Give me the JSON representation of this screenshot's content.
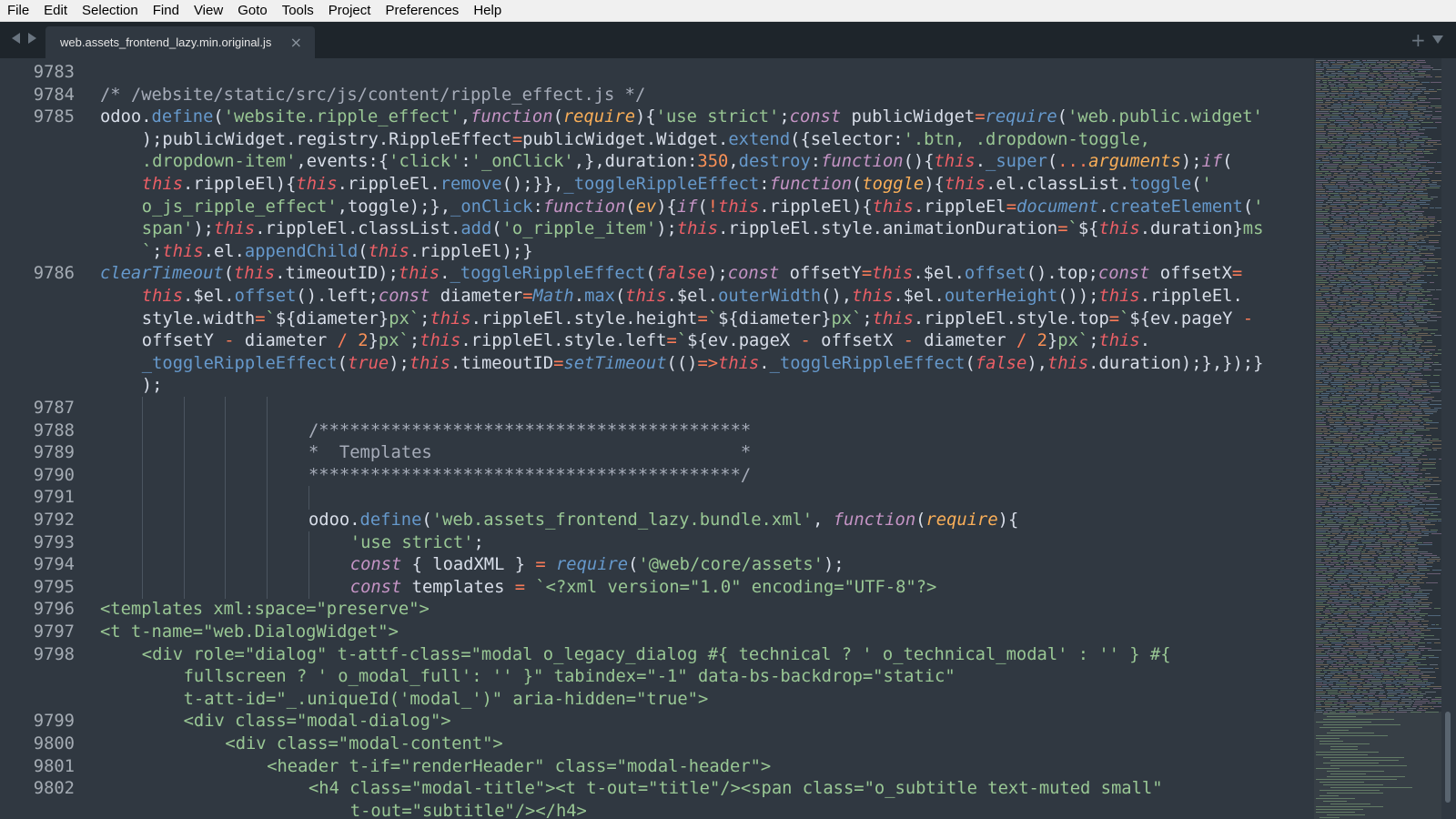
{
  "menu": [
    "File",
    "Edit",
    "Selection",
    "Find",
    "View",
    "Goto",
    "Tools",
    "Project",
    "Preferences",
    "Help"
  ],
  "tab": {
    "title": "web.assets_frontend_lazy.min.original.js",
    "close": "×"
  },
  "tabbar": {
    "new_tab": "+"
  },
  "editor": {
    "lines": [
      {
        "n": "9783",
        "indent": 0,
        "segs": []
      },
      {
        "n": "9784",
        "indent": 0,
        "segs": [
          [
            "c",
            "/* /website/static/src/js/content/ripple_effect.js */"
          ]
        ]
      },
      {
        "n": "9785",
        "indent": 0,
        "segs": [
          [
            "",
            "odoo."
          ],
          [
            "f",
            "define"
          ],
          [
            "",
            "("
          ],
          [
            "s",
            "'website.ripple_effect'"
          ],
          [
            "",
            ","
          ],
          [
            "k",
            "function"
          ],
          [
            "",
            "("
          ],
          [
            "p",
            "require"
          ],
          [
            "",
            "){"
          ],
          [
            "s",
            "'use strict'"
          ],
          [
            "",
            ";"
          ],
          [
            "k",
            "const"
          ],
          [
            "",
            " publicWidget"
          ],
          [
            "op",
            "="
          ],
          [
            "fi",
            "require"
          ],
          [
            "",
            "("
          ],
          [
            "s",
            "'web.public.widget'"
          ]
        ]
      },
      {
        "n": "",
        "indent": 1,
        "segs": [
          [
            "",
            ");publicWidget.registry.RippleEffect"
          ],
          [
            "op",
            "="
          ],
          [
            "",
            "publicWidget.Widget."
          ],
          [
            "f",
            "extend"
          ],
          [
            "",
            "({selector:"
          ],
          [
            "s",
            "'.btn, .dropdown-toggle,"
          ]
        ]
      },
      {
        "n": "",
        "indent": 1,
        "segs": [
          [
            "s",
            ".dropdown-item'"
          ],
          [
            "",
            ",events:{"
          ],
          [
            "s",
            "'click'"
          ],
          [
            "",
            ":"
          ],
          [
            "s",
            "'_onClick'"
          ],
          [
            "",
            ",},duration:"
          ],
          [
            "n",
            "350"
          ],
          [
            "",
            ","
          ],
          [
            "f",
            "destroy"
          ],
          [
            "",
            ":"
          ],
          [
            "k",
            "function"
          ],
          [
            "",
            "(){"
          ],
          [
            "t",
            "this"
          ],
          [
            "",
            "."
          ],
          [
            "f",
            "_super"
          ],
          [
            "",
            "("
          ],
          [
            "op",
            "..."
          ],
          [
            "p",
            "arguments"
          ],
          [
            "",
            ");"
          ],
          [
            "k",
            "if"
          ],
          [
            "",
            "("
          ]
        ]
      },
      {
        "n": "",
        "indent": 1,
        "segs": [
          [
            "t",
            "this"
          ],
          [
            "",
            ".rippleEl){"
          ],
          [
            "t",
            "this"
          ],
          [
            "",
            ".rippleEl."
          ],
          [
            "f",
            "remove"
          ],
          [
            "",
            "();}},"
          ],
          [
            "f",
            "_toggleRippleEffect"
          ],
          [
            "",
            ":"
          ],
          [
            "k",
            "function"
          ],
          [
            "",
            "("
          ],
          [
            "p",
            "toggle"
          ],
          [
            "",
            "){"
          ],
          [
            "t",
            "this"
          ],
          [
            "",
            ".el.classList."
          ],
          [
            "f",
            "toggle"
          ],
          [
            "",
            "("
          ],
          [
            "s",
            "'"
          ]
        ]
      },
      {
        "n": "",
        "indent": 1,
        "segs": [
          [
            "s",
            "o_js_ripple_effect'"
          ],
          [
            "",
            ",toggle);},"
          ],
          [
            "f",
            "_onClick"
          ],
          [
            "",
            ":"
          ],
          [
            "k",
            "function"
          ],
          [
            "",
            "("
          ],
          [
            "p",
            "ev"
          ],
          [
            "",
            "){"
          ],
          [
            "k",
            "if"
          ],
          [
            "",
            "("
          ],
          [
            "op",
            "!"
          ],
          [
            "t",
            "this"
          ],
          [
            "",
            ".rippleEl){"
          ],
          [
            "t",
            "this"
          ],
          [
            "",
            ".rippleEl"
          ],
          [
            "op",
            "="
          ],
          [
            "fi",
            "document"
          ],
          [
            "",
            "."
          ],
          [
            "f",
            "createElement"
          ],
          [
            "",
            "("
          ],
          [
            "s",
            "'"
          ]
        ]
      },
      {
        "n": "",
        "indent": 1,
        "segs": [
          [
            "s",
            "span'"
          ],
          [
            "",
            ");"
          ],
          [
            "t",
            "this"
          ],
          [
            "",
            ".rippleEl.classList."
          ],
          [
            "f",
            "add"
          ],
          [
            "",
            "("
          ],
          [
            "s",
            "'o_ripple_item'"
          ],
          [
            "",
            ");"
          ],
          [
            "t",
            "this"
          ],
          [
            "",
            ".rippleEl.style.animationDuration"
          ],
          [
            "op",
            "="
          ],
          [
            "s",
            "`"
          ],
          [
            "",
            "${"
          ],
          [
            "t",
            "this"
          ],
          [
            "",
            ".duration}"
          ],
          [
            "s",
            "ms"
          ]
        ]
      },
      {
        "n": "",
        "indent": 1,
        "segs": [
          [
            "s",
            "`"
          ],
          [
            "",
            ";"
          ],
          [
            "t",
            "this"
          ],
          [
            "",
            ".el."
          ],
          [
            "f",
            "appendChild"
          ],
          [
            "",
            "("
          ],
          [
            "t",
            "this"
          ],
          [
            "",
            ".rippleEl);}"
          ]
        ]
      },
      {
        "n": "9786",
        "indent": 0,
        "segs": [
          [
            "fi",
            "clearTimeout"
          ],
          [
            "",
            "("
          ],
          [
            "t",
            "this"
          ],
          [
            "",
            ".timeoutID);"
          ],
          [
            "t",
            "this"
          ],
          [
            "",
            "."
          ],
          [
            "f",
            "_toggleRippleEffect"
          ],
          [
            "",
            "("
          ],
          [
            "t",
            "false"
          ],
          [
            "",
            ");"
          ],
          [
            "k",
            "const"
          ],
          [
            "",
            " offsetY"
          ],
          [
            "op",
            "="
          ],
          [
            "t",
            "this"
          ],
          [
            "",
            ".$el."
          ],
          [
            "f",
            "offset"
          ],
          [
            "",
            "().top;"
          ],
          [
            "k",
            "const"
          ],
          [
            "",
            " offsetX"
          ],
          [
            "op",
            "="
          ]
        ]
      },
      {
        "n": "",
        "indent": 1,
        "segs": [
          [
            "t",
            "this"
          ],
          [
            "",
            ".$el."
          ],
          [
            "f",
            "offset"
          ],
          [
            "",
            "().left;"
          ],
          [
            "k",
            "const"
          ],
          [
            "",
            " diameter"
          ],
          [
            "op",
            "="
          ],
          [
            "fi",
            "Math"
          ],
          [
            "",
            "."
          ],
          [
            "f",
            "max"
          ],
          [
            "",
            "("
          ],
          [
            "t",
            "this"
          ],
          [
            "",
            ".$el."
          ],
          [
            "f",
            "outerWidth"
          ],
          [
            "",
            "(),"
          ],
          [
            "t",
            "this"
          ],
          [
            "",
            ".$el."
          ],
          [
            "f",
            "outerHeight"
          ],
          [
            "",
            "());"
          ],
          [
            "t",
            "this"
          ],
          [
            "",
            ".rippleEl."
          ]
        ]
      },
      {
        "n": "",
        "indent": 1,
        "segs": [
          [
            "",
            "style.width"
          ],
          [
            "op",
            "="
          ],
          [
            "s",
            "`"
          ],
          [
            "",
            "${diameter}"
          ],
          [
            "s",
            "px`"
          ],
          [
            "",
            ";"
          ],
          [
            "t",
            "this"
          ],
          [
            "",
            ".rippleEl.style.height"
          ],
          [
            "op",
            "="
          ],
          [
            "s",
            "`"
          ],
          [
            "",
            "${diameter}"
          ],
          [
            "s",
            "px`"
          ],
          [
            "",
            ";"
          ],
          [
            "t",
            "this"
          ],
          [
            "",
            ".rippleEl.style.top"
          ],
          [
            "op",
            "="
          ],
          [
            "s",
            "`"
          ],
          [
            "",
            "${ev.pageY "
          ],
          [
            "op",
            "-"
          ]
        ]
      },
      {
        "n": "",
        "indent": 1,
        "segs": [
          [
            "",
            "offsetY "
          ],
          [
            "op",
            "-"
          ],
          [
            "",
            " diameter "
          ],
          [
            "op",
            "/"
          ],
          [
            "",
            " "
          ],
          [
            "n",
            "2"
          ],
          [
            "",
            "}"
          ],
          [
            "s",
            "px`"
          ],
          [
            "",
            ";"
          ],
          [
            "t",
            "this"
          ],
          [
            "",
            ".rippleEl.style.left"
          ],
          [
            "op",
            "="
          ],
          [
            "s",
            "`"
          ],
          [
            "",
            "${ev.pageX "
          ],
          [
            "op",
            "-"
          ],
          [
            "",
            " offsetX "
          ],
          [
            "op",
            "-"
          ],
          [
            "",
            " diameter "
          ],
          [
            "op",
            "/"
          ],
          [
            "",
            " "
          ],
          [
            "n",
            "2"
          ],
          [
            "",
            "}"
          ],
          [
            "s",
            "px`"
          ],
          [
            "",
            ";"
          ],
          [
            "t",
            "this"
          ],
          [
            "",
            "."
          ]
        ]
      },
      {
        "n": "",
        "indent": 1,
        "segs": [
          [
            "f",
            "_toggleRippleEffect"
          ],
          [
            "",
            "("
          ],
          [
            "t",
            "true"
          ],
          [
            "",
            ");"
          ],
          [
            "t",
            "this"
          ],
          [
            "",
            ".timeoutID"
          ],
          [
            "op",
            "="
          ],
          [
            "fi",
            "setTimeout"
          ],
          [
            "",
            "(()"
          ],
          [
            "op",
            "=>"
          ],
          [
            "t",
            "this"
          ],
          [
            "",
            "."
          ],
          [
            "f",
            "_toggleRippleEffect"
          ],
          [
            "",
            "("
          ],
          [
            "t",
            "false"
          ],
          [
            "",
            "),"
          ],
          [
            "t",
            "this"
          ],
          [
            "",
            ".duration);},});}"
          ]
        ]
      },
      {
        "n": "",
        "indent": 1,
        "segs": [
          [
            "",
            ");"
          ]
        ]
      },
      {
        "n": "9787",
        "indent": 0,
        "segs": []
      },
      {
        "n": "9788",
        "indent": 5,
        "segs": [
          [
            "c",
            "/******************************************"
          ]
        ]
      },
      {
        "n": "9789",
        "indent": 5,
        "segs": [
          [
            "c",
            "*  Templates                              *"
          ]
        ]
      },
      {
        "n": "9790",
        "indent": 5,
        "segs": [
          [
            "c",
            "******************************************/"
          ]
        ]
      },
      {
        "n": "9791",
        "indent": 0,
        "segs": []
      },
      {
        "n": "9792",
        "indent": 5,
        "segs": [
          [
            "",
            "odoo."
          ],
          [
            "f",
            "define"
          ],
          [
            "",
            "("
          ],
          [
            "s",
            "'web.assets_frontend_lazy.bundle.xml'"
          ],
          [
            "",
            ", "
          ],
          [
            "k",
            "function"
          ],
          [
            "",
            "("
          ],
          [
            "p",
            "require"
          ],
          [
            "",
            "){"
          ]
        ]
      },
      {
        "n": "9793",
        "indent": 6,
        "segs": [
          [
            "s",
            "'use strict'"
          ],
          [
            "",
            ";"
          ]
        ]
      },
      {
        "n": "9794",
        "indent": 6,
        "segs": [
          [
            "k",
            "const"
          ],
          [
            "",
            " { loadXML } "
          ],
          [
            "op",
            "="
          ],
          [
            "",
            " "
          ],
          [
            "fi",
            "require"
          ],
          [
            "",
            "("
          ],
          [
            "s",
            "'@web/core/assets'"
          ],
          [
            "",
            ");"
          ]
        ]
      },
      {
        "n": "9795",
        "indent": 6,
        "segs": [
          [
            "k",
            "const"
          ],
          [
            "",
            " templates "
          ],
          [
            "op",
            "="
          ],
          [
            "",
            " "
          ],
          [
            "s",
            "`<?xml version=\"1.0\" encoding=\"UTF-8\"?>"
          ]
        ]
      },
      {
        "n": "9796",
        "indent": 0,
        "segs": [
          [
            "s",
            "<templates xml:space=\"preserve\">"
          ]
        ]
      },
      {
        "n": "9797",
        "indent": 0,
        "segs": [
          [
            "s",
            "<t t-name=\"web.DialogWidget\">"
          ]
        ]
      },
      {
        "n": "9798",
        "indent": 1,
        "segs": [
          [
            "s",
            "<div role=\"dialog\" t-attf-class=\"modal o_legacy_dialog #{ technical ? ' o_technical_modal' : '' } #{"
          ]
        ]
      },
      {
        "n": "",
        "indent": 2,
        "segs": [
          [
            "s",
            "fullscreen ? ' o_modal_full': '' }\" tabindex=\"-1\" data-bs-backdrop=\"static\""
          ]
        ]
      },
      {
        "n": "",
        "indent": 2,
        "segs": [
          [
            "s",
            "t-att-id=\"_.uniqueId('modal_')\" aria-hidden=\"true\">"
          ]
        ]
      },
      {
        "n": "9799",
        "indent": 2,
        "segs": [
          [
            "s",
            "<div class=\"modal-dialog\">"
          ]
        ]
      },
      {
        "n": "9800",
        "indent": 3,
        "segs": [
          [
            "s",
            "<div class=\"modal-content\">"
          ]
        ]
      },
      {
        "n": "9801",
        "indent": 4,
        "segs": [
          [
            "s",
            "<header t-if=\"renderHeader\" class=\"modal-header\">"
          ]
        ]
      },
      {
        "n": "9802",
        "indent": 5,
        "segs": [
          [
            "s",
            "<h4 class=\"modal-title\"><t t-out=\"title\"/><span class=\"o_subtitle text-muted small\""
          ]
        ]
      },
      {
        "n": "",
        "indent": 6,
        "segs": [
          [
            "s",
            "t-out=\"subtitle\"/></h4>"
          ]
        ]
      }
    ]
  },
  "colors": {
    "background": "#303841",
    "tabbar": "#1e252b",
    "comment": "#a6acb9",
    "string": "#99c794",
    "keyword": "#c594c5",
    "function": "#6699cc",
    "number": "#f99157",
    "this": "#ec5f66",
    "operator": "#f97b58",
    "parameter": "#f9ae58"
  },
  "icons": {
    "nav_left": "triangle-left-icon",
    "nav_right": "triangle-right-icon",
    "tab_close": "close-icon",
    "new_tab": "plus-icon",
    "tab_menu": "chevron-down-icon"
  }
}
